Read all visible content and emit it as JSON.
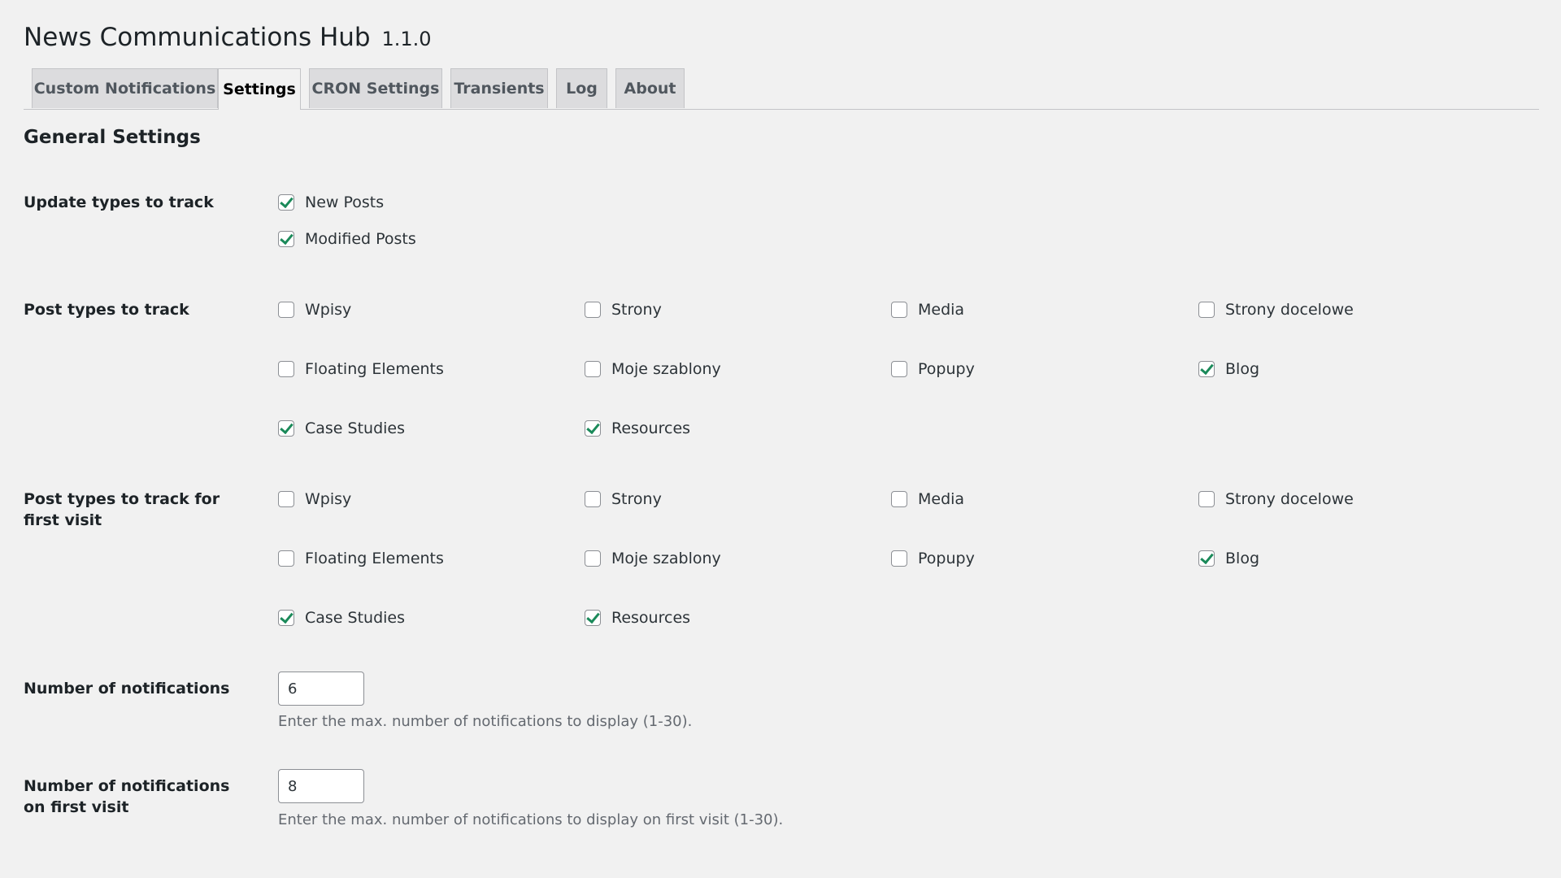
{
  "header": {
    "title": "News Communications Hub",
    "version": "1.1.0"
  },
  "tabs": [
    {
      "label": "Custom Notifications",
      "active": false
    },
    {
      "label": "Settings",
      "active": true
    },
    {
      "label": "CRON Settings",
      "active": false
    },
    {
      "label": "Transients",
      "active": false
    },
    {
      "label": "Log",
      "active": false
    },
    {
      "label": "About",
      "active": false
    }
  ],
  "section_title": "General Settings",
  "update_types": {
    "label": "Update types to track",
    "options": [
      {
        "label": "New Posts",
        "checked": true
      },
      {
        "label": "Modified Posts",
        "checked": true
      }
    ]
  },
  "post_types": {
    "label": "Post types to track",
    "options": [
      {
        "label": "Wpisy",
        "checked": false
      },
      {
        "label": "Strony",
        "checked": false
      },
      {
        "label": "Media",
        "checked": false
      },
      {
        "label": "Strony docelowe",
        "checked": false
      },
      {
        "label": "Floating Elements",
        "checked": false
      },
      {
        "label": "Moje szablony",
        "checked": false
      },
      {
        "label": "Popupy",
        "checked": false
      },
      {
        "label": "Blog",
        "checked": true
      },
      {
        "label": "Case Studies",
        "checked": true
      },
      {
        "label": "Resources",
        "checked": true
      }
    ]
  },
  "post_types_first_visit": {
    "label": "Post types to track for first visit",
    "options": [
      {
        "label": "Wpisy",
        "checked": false
      },
      {
        "label": "Strony",
        "checked": false
      },
      {
        "label": "Media",
        "checked": false
      },
      {
        "label": "Strony docelowe",
        "checked": false
      },
      {
        "label": "Floating Elements",
        "checked": false
      },
      {
        "label": "Moje szablony",
        "checked": false
      },
      {
        "label": "Popupy",
        "checked": false
      },
      {
        "label": "Blog",
        "checked": true
      },
      {
        "label": "Case Studies",
        "checked": true
      },
      {
        "label": "Resources",
        "checked": true
      }
    ]
  },
  "num_notifications": {
    "label": "Number of notifications",
    "value": "6",
    "description": "Enter the max. number of notifications to display (1-30)."
  },
  "num_notifications_first_visit": {
    "label": "Number of notifications on first visit",
    "value": "8",
    "description": "Enter the max. number of notifications to display on first visit (1-30)."
  }
}
